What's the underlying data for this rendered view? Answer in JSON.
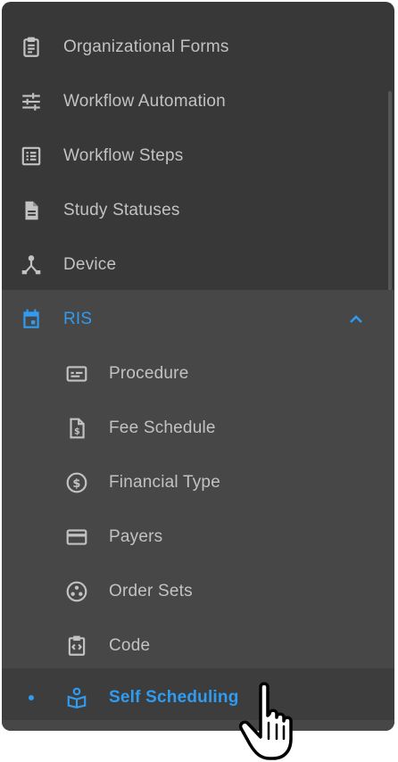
{
  "menu": {
    "top_items": [
      {
        "label": "Organizational Forms",
        "icon": "clipboard-icon"
      },
      {
        "label": "Workflow Automation",
        "icon": "tune-sliders-icon"
      },
      {
        "label": "Workflow Steps",
        "icon": "list-icon"
      },
      {
        "label": "Study Statuses",
        "icon": "document-icon"
      },
      {
        "label": "Device",
        "icon": "device-hub-icon"
      }
    ],
    "ris": {
      "label": "RIS",
      "icon": "calendar-icon",
      "expanded": true
    },
    "sub_items": [
      {
        "label": "Procedure",
        "icon": "card-icon"
      },
      {
        "label": "Fee Schedule",
        "icon": "invoice-dollar-icon"
      },
      {
        "label": "Financial Type",
        "icon": "dollar-circle-icon"
      },
      {
        "label": "Payers",
        "icon": "credit-card-icon"
      },
      {
        "label": "Order Sets",
        "icon": "dots-circle-icon"
      },
      {
        "label": "Code",
        "icon": "code-clipboard-icon"
      },
      {
        "label": "Self Scheduling",
        "icon": "person-book-icon",
        "selected": true
      }
    ]
  },
  "colors": {
    "panel_bg": "#383838",
    "group_bg": "#474747",
    "text": "#c2c2c2",
    "accent": "#2f9bf1"
  }
}
